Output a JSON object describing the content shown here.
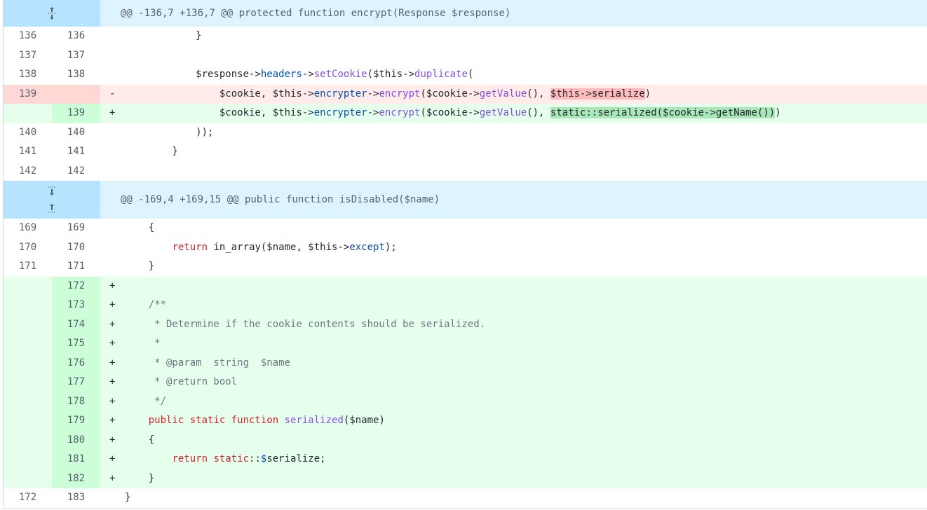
{
  "hunks": [
    {
      "header": "@@ -136,7 +136,7 @@ protected function encrypt(Response $response)",
      "expand_icon": "unfold-icon"
    },
    {
      "header": "@@ -169,4 +169,15 @@ public function isDisabled($name)",
      "expand_icon": "expand-up-down-icon"
    }
  ],
  "lines_h1": [
    {
      "old": "136",
      "new": "136",
      "marker": "",
      "tokens": [
        [
          "t",
          "            }"
        ]
      ],
      "type": "ctx"
    },
    {
      "old": "137",
      "new": "137",
      "marker": "",
      "tokens": [],
      "type": "ctx"
    },
    {
      "old": "138",
      "new": "138",
      "marker": "",
      "tokens": [
        [
          "t",
          "            $response->"
        ],
        [
          "p",
          "headers"
        ],
        [
          "t",
          "->"
        ],
        [
          "f",
          "setCookie"
        ],
        [
          "t",
          "($this->"
        ],
        [
          "f",
          "duplicate"
        ],
        [
          "t",
          "("
        ]
      ],
      "type": "ctx"
    },
    {
      "old": "139",
      "new": "",
      "marker": "-",
      "tokens": [
        [
          "t",
          "                $cookie, $this->"
        ],
        [
          "p",
          "encrypter"
        ],
        [
          "t",
          "->"
        ],
        [
          "f",
          "encrypt"
        ],
        [
          "t",
          "($cookie->"
        ],
        [
          "f",
          "getValue"
        ],
        [
          "t",
          "(), "
        ],
        [
          "hd",
          "$this->serialize"
        ],
        [
          "t",
          ")"
        ]
      ],
      "type": "del"
    },
    {
      "old": "",
      "new": "139",
      "marker": "+",
      "tokens": [
        [
          "t",
          "                $cookie, $this->"
        ],
        [
          "p",
          "encrypter"
        ],
        [
          "t",
          "->"
        ],
        [
          "f",
          "encrypt"
        ],
        [
          "t",
          "($cookie->"
        ],
        [
          "f",
          "getValue"
        ],
        [
          "t",
          "(), "
        ],
        [
          "ha",
          "static::serialized($cookie->getName())"
        ],
        [
          "t",
          ")"
        ]
      ],
      "type": "add"
    },
    {
      "old": "140",
      "new": "140",
      "marker": "",
      "tokens": [
        [
          "t",
          "            ));"
        ]
      ],
      "type": "ctx"
    },
    {
      "old": "141",
      "new": "141",
      "marker": "",
      "tokens": [
        [
          "t",
          "        }"
        ]
      ],
      "type": "ctx"
    },
    {
      "old": "142",
      "new": "142",
      "marker": "",
      "tokens": [],
      "type": "ctx"
    }
  ],
  "lines_h2": [
    {
      "old": "169",
      "new": "169",
      "marker": "",
      "tokens": [
        [
          "t",
          "    {"
        ]
      ],
      "type": "ctx"
    },
    {
      "old": "170",
      "new": "170",
      "marker": "",
      "tokens": [
        [
          "t",
          "        "
        ],
        [
          "k",
          "return"
        ],
        [
          "t",
          " in_array($name, $this->"
        ],
        [
          "p",
          "except"
        ],
        [
          "t",
          ");"
        ]
      ],
      "type": "ctx"
    },
    {
      "old": "171",
      "new": "171",
      "marker": "",
      "tokens": [
        [
          "t",
          "    }"
        ]
      ],
      "type": "ctx"
    },
    {
      "old": "",
      "new": "172",
      "marker": "+",
      "tokens": [],
      "type": "add"
    },
    {
      "old": "",
      "new": "173",
      "marker": "+",
      "tokens": [
        [
          "c",
          "    /**"
        ]
      ],
      "type": "add"
    },
    {
      "old": "",
      "new": "174",
      "marker": "+",
      "tokens": [
        [
          "c",
          "     * Determine if the cookie contents should be serialized."
        ]
      ],
      "type": "add"
    },
    {
      "old": "",
      "new": "175",
      "marker": "+",
      "tokens": [
        [
          "c",
          "     *"
        ]
      ],
      "type": "add"
    },
    {
      "old": "",
      "new": "176",
      "marker": "+",
      "tokens": [
        [
          "c",
          "     * @param  string  $name"
        ]
      ],
      "type": "add"
    },
    {
      "old": "",
      "new": "177",
      "marker": "+",
      "tokens": [
        [
          "c",
          "     * @return bool"
        ]
      ],
      "type": "add"
    },
    {
      "old": "",
      "new": "178",
      "marker": "+",
      "tokens": [
        [
          "c",
          "     */"
        ]
      ],
      "type": "add"
    },
    {
      "old": "",
      "new": "179",
      "marker": "+",
      "tokens": [
        [
          "t",
          "    "
        ],
        [
          "k",
          "public static function "
        ],
        [
          "f",
          "serialized"
        ],
        [
          "t",
          "($name)"
        ]
      ],
      "type": "add"
    },
    {
      "old": "",
      "new": "180",
      "marker": "+",
      "tokens": [
        [
          "t",
          "    {"
        ]
      ],
      "type": "add"
    },
    {
      "old": "",
      "new": "181",
      "marker": "+",
      "tokens": [
        [
          "t",
          "        "
        ],
        [
          "k",
          "return static"
        ],
        [
          "t",
          "::"
        ],
        [
          "p",
          "$"
        ],
        [
          "t",
          "serialize;"
        ]
      ],
      "type": "add"
    },
    {
      "old": "",
      "new": "182",
      "marker": "+",
      "tokens": [
        [
          "t",
          "    }"
        ]
      ],
      "type": "add"
    },
    {
      "old": "172",
      "new": "183",
      "marker": "",
      "tokens": [
        [
          "t",
          "}"
        ]
      ],
      "type": "ctx"
    }
  ],
  "colors": {
    "hunk_bg": "#ddf4ff",
    "hunk_gutter": "#b6e3ff",
    "add_bg": "#e6ffec",
    "add_gutter": "#ccffd8",
    "del_bg": "#ffebe9",
    "del_gutter": "#ffd7d5"
  }
}
